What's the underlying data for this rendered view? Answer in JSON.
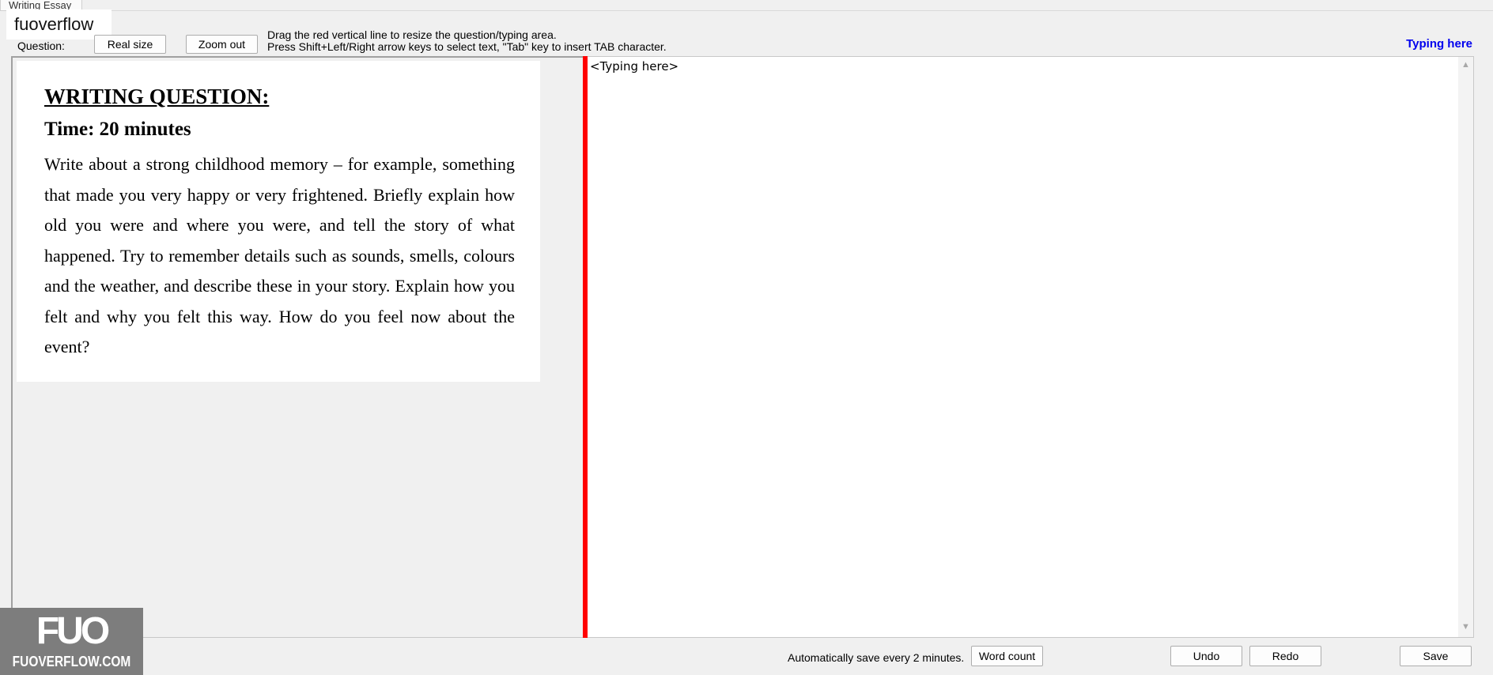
{
  "window": {
    "tab_label": "Writing Essay"
  },
  "watermark": {
    "top_label": "fuoverflow",
    "logo_mark": "FUO",
    "logo_text": "FUOVERFLOW.COM"
  },
  "toolbar": {
    "question_label": "Question:",
    "real_size_label": "Real size",
    "zoom_out_label": "Zoom out",
    "hint_line1": "Drag the red vertical line to resize the question/typing area.",
    "hint_line2": "Press Shift+Left/Right arrow keys to select text, \"Tab\" key to insert TAB character.",
    "typing_here_link": "Typing here"
  },
  "question": {
    "title": "WRITING QUESTION:",
    "time": "Time: 20 minutes",
    "body": " Write about a strong childhood memory – for example, something that made you very happy or very frightened. Briefly explain how old you were and where you were, and tell the story of what happened. Try to remember details such as sounds, smells, colours and the weather, and describe these in your story. Explain how you felt and why you felt this way. How do you feel now about the event?"
  },
  "editor": {
    "placeholder_text": "<Typing here>"
  },
  "bottom_bar": {
    "autosave_text": "Automatically save every 2 minutes.",
    "word_count_label": "Word count",
    "undo_label": "Undo",
    "redo_label": "Redo",
    "save_label": "Save"
  },
  "icons": {
    "scroll_up": "scroll-up-arrow-icon",
    "scroll_down": "scroll-down-arrow-icon"
  },
  "colors": {
    "divider": "#ff0000",
    "link": "#0000ee"
  }
}
